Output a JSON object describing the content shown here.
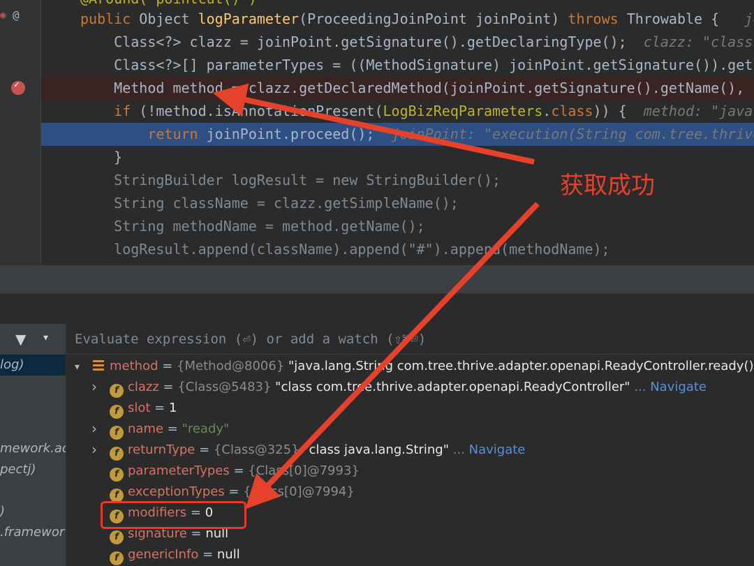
{
  "editor": {
    "lines": [
      {
        "segs": [
          [
            "ann",
            "@Around(\"pointcut()\")"
          ]
        ]
      },
      {
        "segs": [
          [
            "kw",
            "public "
          ],
          [
            "",
            "Object "
          ],
          [
            "fn",
            "logParameter"
          ],
          [
            "",
            "(ProceedingJoinPoint joinPoint) "
          ],
          [
            "kw",
            "throws "
          ],
          [
            "",
            "Throwable {   "
          ],
          [
            "hint",
            "joinPoint: \"execution(String com.tree.thrive.adapter.openapi"
          ]
        ]
      },
      {
        "segs": [
          [
            "",
            "    Class<?> clazz = joinPoint.getSignature().getDeclaringType();  "
          ],
          [
            "hint",
            "clazz: \"class com.tree.thrive.adapter.openapi.ReadyController\""
          ]
        ]
      },
      {
        "segs": [
          [
            "",
            "    Class<?>[] parameterTypes = ((MethodSignature) joinPoint.getSignature()).getParameterTypes();"
          ]
        ]
      },
      {
        "segs": [
          [
            "",
            "    Method method = clazz.getDeclaredMethod(joinPoint.getSignature().getName(), parameterTypes);"
          ]
        ]
      },
      {
        "segs": [
          [
            "kw",
            "    if "
          ],
          [
            "",
            "(!method.isAnnotationPresent("
          ],
          [
            "ann",
            "LogBizReqParameters"
          ],
          [
            "",
            "."
          ],
          [
            "kw",
            "class"
          ],
          [
            "",
            ")) {  "
          ],
          [
            "hint",
            "method: \"java.lang.String com.tree.thrive\""
          ]
        ]
      },
      {
        "segs": [
          [
            "kw",
            "        return "
          ],
          [
            "",
            "joinPoint.proceed();  "
          ],
          [
            "hint",
            "joinPoint: \"execution(String com.tree.thrive.adapter.openapi\""
          ]
        ]
      },
      {
        "segs": [
          [
            "",
            "    }"
          ]
        ]
      },
      {
        "segs": [
          [
            "dim",
            "    StringBuilder logResult = new StringBuilder();"
          ]
        ]
      },
      {
        "segs": [
          [
            "dim",
            "    String className = clazz.getSimpleName();"
          ]
        ]
      },
      {
        "segs": [
          [
            "dim",
            "    String methodName = method.getName();"
          ]
        ]
      },
      {
        "segs": [
          [
            "dim",
            "    logResult.append(className).append(\"#\").append(methodName);"
          ]
        ]
      }
    ]
  },
  "frames": {
    "items": [
      "log)",
      "",
      "",
      "",
      "mework.ac",
      "pectj)",
      "",
      ")",
      ".framewor"
    ]
  },
  "debugger": {
    "eval_placeholder": "Evaluate expression (⏎) or add a watch (⇧⌘⏎)",
    "variables": [
      {
        "arrow": "expanded",
        "icon": "list",
        "name": "method",
        "type": "{Method@8006}",
        "value": "\"java.lang.String com.tree.thrive.adapter.openapi.ReadyController.ready()\"",
        "nav": ""
      },
      {
        "arrow": "collapsed",
        "icon": "f",
        "name": "clazz",
        "type": "{Class@5483}",
        "value": "\"class com.tree.thrive.adapter.openapi.ReadyController\"",
        "nav": "... Navigate"
      },
      {
        "arrow": "",
        "icon": "f",
        "name": "slot",
        "type": "",
        "value": "1",
        "nav": ""
      },
      {
        "arrow": "collapsed",
        "icon": "f",
        "name": "name",
        "type": "",
        "value": "\"ready\"",
        "nav": "",
        "isStr": true
      },
      {
        "arrow": "collapsed",
        "icon": "f",
        "name": "returnType",
        "type": "{Class@325}",
        "value": "\"class java.lang.String\"",
        "nav": "... Navigate"
      },
      {
        "arrow": "",
        "icon": "f",
        "name": "parameterTypes",
        "type": "{Class[0]@7993}",
        "value": "",
        "nav": ""
      },
      {
        "arrow": "",
        "icon": "f",
        "name": "exceptionTypes",
        "type": "{Class[0]@7994}",
        "value": "",
        "nav": ""
      },
      {
        "arrow": "",
        "icon": "f",
        "name": "modifiers",
        "type": "",
        "value": "0",
        "nav": ""
      },
      {
        "arrow": "",
        "icon": "f",
        "name": "signature",
        "type": "",
        "value": "null",
        "nav": ""
      },
      {
        "arrow": "",
        "icon": "f",
        "name": "genericInfo",
        "type": "",
        "value": "null",
        "nav": ""
      }
    ]
  },
  "annotation": {
    "label": "获取成功",
    "color": "#e5412b"
  }
}
